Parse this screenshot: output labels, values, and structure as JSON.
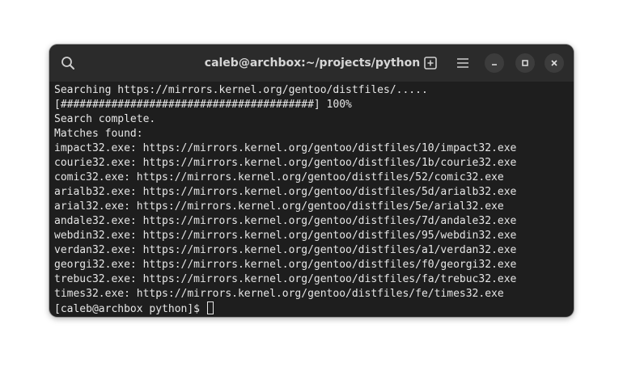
{
  "window": {
    "title": "caleb@archbox:~/projects/python"
  },
  "headerbar": {
    "search_icon": "search-icon",
    "new_tab_icon": "new-tab-plus-icon",
    "menu_icon": "hamburger-menu-icon",
    "minimize_icon": "minimize-icon",
    "maximize_icon": "maximize-icon",
    "close_icon": "close-icon"
  },
  "terminal": {
    "lines": [
      "Searching https://mirrors.kernel.org/gentoo/distfiles/.....",
      "[########################################] 100%",
      "Search complete.",
      "Matches found:",
      "impact32.exe: https://mirrors.kernel.org/gentoo/distfiles/10/impact32.exe",
      "courie32.exe: https://mirrors.kernel.org/gentoo/distfiles/1b/courie32.exe",
      "comic32.exe: https://mirrors.kernel.org/gentoo/distfiles/52/comic32.exe",
      "arialb32.exe: https://mirrors.kernel.org/gentoo/distfiles/5d/arialb32.exe",
      "arial32.exe: https://mirrors.kernel.org/gentoo/distfiles/5e/arial32.exe",
      "andale32.exe: https://mirrors.kernel.org/gentoo/distfiles/7d/andale32.exe",
      "webdin32.exe: https://mirrors.kernel.org/gentoo/distfiles/95/webdin32.exe",
      "verdan32.exe: https://mirrors.kernel.org/gentoo/distfiles/a1/verdan32.exe",
      "georgi32.exe: https://mirrors.kernel.org/gentoo/distfiles/f0/georgi32.exe",
      "trebuc32.exe: https://mirrors.kernel.org/gentoo/distfiles/fa/trebuc32.exe",
      "times32.exe: https://mirrors.kernel.org/gentoo/distfiles/fe/times32.exe"
    ],
    "prompt": "[caleb@archbox python]$ "
  },
  "colors": {
    "terminal_bg": "#1e1e1e",
    "headerbar_bg": "#2b2b2b",
    "text": "#e6e6e6"
  }
}
